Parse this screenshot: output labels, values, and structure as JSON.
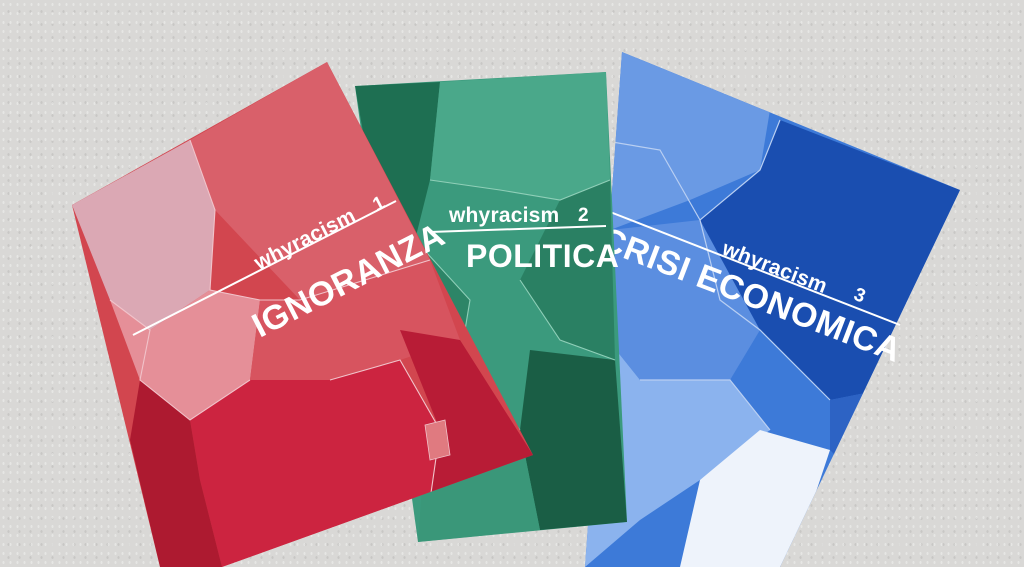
{
  "scene": {
    "background_color": "#d9d8d6"
  },
  "booklets": [
    {
      "color": "#c93a4e",
      "series": "whyracism",
      "number": "1",
      "title": "IGNORANZA"
    },
    {
      "color": "#2f8f72",
      "series": "whyracism",
      "number": "2",
      "title": "POLITICA"
    },
    {
      "color": "#2f6fd0",
      "series": "whyracism",
      "number": "3",
      "title": "CRISI ECONOMICA"
    }
  ]
}
